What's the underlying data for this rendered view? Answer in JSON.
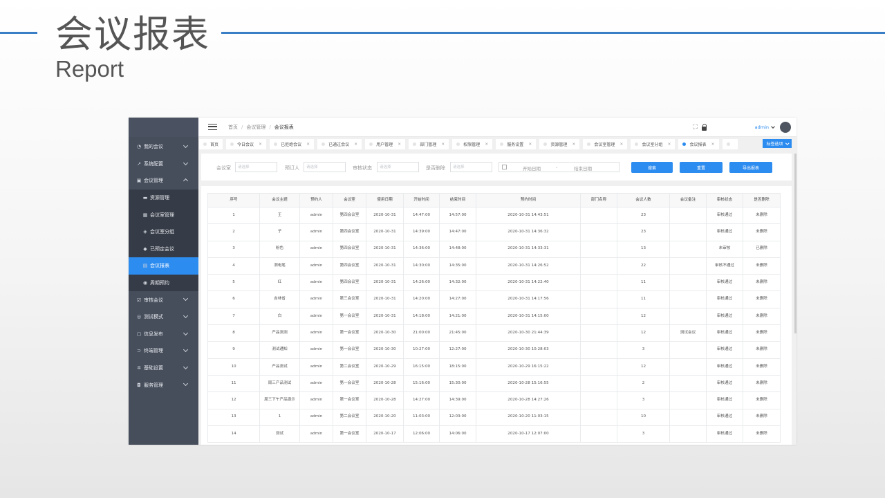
{
  "slide": {
    "title": "会议报表",
    "subtitle": "Report"
  },
  "sidebar": {
    "items": [
      {
        "label": "我的会议",
        "icon": "gauge-icon"
      },
      {
        "label": "系统配置",
        "icon": "wrench-icon"
      },
      {
        "label": "会议管理",
        "icon": "calendar-icon"
      }
    ],
    "submenu": [
      {
        "label": "资源管理",
        "icon": "server-icon"
      },
      {
        "label": "会议室管理",
        "icon": "room-icon"
      },
      {
        "label": "会议室分组",
        "icon": "layers-icon"
      },
      {
        "label": "已预定会议",
        "icon": "cube-icon"
      },
      {
        "label": "会议报表",
        "icon": "report-icon"
      },
      {
        "label": "周期预约",
        "icon": "cycle-icon"
      }
    ],
    "items_after": [
      {
        "label": "审核会议",
        "icon": "check-calendar-icon"
      },
      {
        "label": "测试模式",
        "icon": "test-icon"
      },
      {
        "label": "信息发布",
        "icon": "info-icon"
      },
      {
        "label": "终端管理",
        "icon": "terminal-icon"
      },
      {
        "label": "基础设置",
        "icon": "gear-icon"
      },
      {
        "label": "服务管理",
        "icon": "database-icon"
      }
    ]
  },
  "breadcrumb": [
    "首页",
    "会议管理",
    "会议报表"
  ],
  "header": {
    "user": "admin"
  },
  "tabs": [
    {
      "label": "首页",
      "closable": false
    },
    {
      "label": "今日会议",
      "closable": true
    },
    {
      "label": "已拒绝会议",
      "closable": true
    },
    {
      "label": "已通过会议",
      "closable": true
    },
    {
      "label": "用户管理",
      "closable": true
    },
    {
      "label": "部门管理",
      "closable": true
    },
    {
      "label": "权限管理",
      "closable": true
    },
    {
      "label": "服务设置",
      "closable": true
    },
    {
      "label": "资源管理",
      "closable": true
    },
    {
      "label": "会议室管理",
      "closable": true
    },
    {
      "label": "会议室分组",
      "closable": true
    },
    {
      "label": "会议报表",
      "closable": true
    },
    {
      "label": "",
      "closable": false
    }
  ],
  "tab_menu": "标签选项",
  "filters": {
    "room_label": "会议室",
    "room_placeholder": "请选择",
    "booker_label": "预订人",
    "booker_placeholder": "请选择",
    "status_label": "审核状态",
    "status_placeholder": "请选择",
    "deleted_label": "是否删除",
    "deleted_placeholder": "请选择",
    "start_date": "开始日期",
    "date_sep": "-",
    "end_date": "结束日期",
    "search_btn": "搜索",
    "reset_btn": "重置",
    "export_btn": "导出报表"
  },
  "table": {
    "columns": [
      "序号",
      "会议主题",
      "预约人",
      "会议室",
      "使用日期",
      "开始时间",
      "结束时间",
      "预约时间",
      "部门名称",
      "会议人数",
      "会议备注",
      "审核状态",
      "是否删除"
    ],
    "rows": [
      [
        "1",
        "王",
        "admin",
        "第四会议室",
        "2020-10-31",
        "14:47:00",
        "14:57:00",
        "2020-10-31 14:43:51",
        "",
        "23",
        "",
        "审核通过",
        "未删除"
      ],
      [
        "2",
        "子",
        "admin",
        "第四会议室",
        "2020-10-31",
        "14:39:00",
        "14:47:00",
        "2020-10-31 14:36:32",
        "",
        "23",
        "",
        "审核通过",
        "未删除"
      ],
      [
        "3",
        "粉色",
        "admin",
        "第四会议室",
        "2020-10-31",
        "14:36:00",
        "14:48:00",
        "2020-10-31 14:33:31",
        "",
        "13",
        "",
        "未审核",
        "已删除"
      ],
      [
        "4",
        "洞电笔",
        "admin",
        "第四会议室",
        "2020-10-31",
        "14:30:00",
        "14:35:00",
        "2020-10-31 14:26:52",
        "",
        "22",
        "",
        "审核不通过",
        "未删除"
      ],
      [
        "5",
        "红",
        "admin",
        "第四会议室",
        "2020-10-31",
        "14:26:00",
        "14:32:00",
        "2020-10-31 14:22:40",
        "",
        "11",
        "",
        "审核通过",
        "未删除"
      ],
      [
        "6",
        "吉林省",
        "admin",
        "第三会议室",
        "2020-10-31",
        "14:20:00",
        "14:27:00",
        "2020-10-31 14:17:56",
        "",
        "11",
        "",
        "审核通过",
        "未删除"
      ],
      [
        "7",
        "白",
        "admin",
        "第一会议室",
        "2020-10-31",
        "14:18:00",
        "14:21:00",
        "2020-10-31 14:15:00",
        "",
        "12",
        "",
        "审核通过",
        "未删除"
      ],
      [
        "8",
        "产品测测",
        "admin",
        "第一会议室",
        "2020-10-30",
        "21:00:00",
        "21:45:00",
        "2020-10-30 21:44:39",
        "",
        "12",
        "测试会议",
        "审核通过",
        "未删除"
      ],
      [
        "9",
        "测试通知",
        "admin",
        "第一会议室",
        "2020-10-30",
        "10:27:00",
        "12:27:00",
        "2020-10-30 10:28:03",
        "",
        "3",
        "",
        "审核通过",
        "未删除"
      ],
      [
        "10",
        "产品测试",
        "admin",
        "第二会议室",
        "2020-10-29",
        "16:15:00",
        "18:15:00",
        "2020-10-29 16:15:22",
        "",
        "12",
        "",
        "审核通过",
        "未删除"
      ],
      [
        "11",
        "周三产品测试",
        "admin",
        "第一会议室",
        "2020-10-28",
        "15:16:00",
        "15:30:00",
        "2020-10-28 15:16:55",
        "",
        "2",
        "",
        "审核通过",
        "未删除"
      ],
      [
        "12",
        "周三下午产品演示",
        "admin",
        "第一会议室",
        "2020-10-28",
        "14:27:00",
        "14:39:00",
        "2020-10-28 14:27:26",
        "",
        "3",
        "",
        "审核通过",
        "未删除"
      ],
      [
        "13",
        "1",
        "admin",
        "第二会议室",
        "2020-10-20",
        "11:03:00",
        "12:03:00",
        "2020-10-20 11:03:15",
        "",
        "10",
        "",
        "审核通过",
        "未删除"
      ],
      [
        "14",
        "测试",
        "admin",
        "第一会议室",
        "2020-10-17",
        "12:06:00",
        "14:06:00",
        "2020-10-17 12:07:00",
        "",
        "3",
        "",
        "审核通过",
        "未删除"
      ]
    ]
  }
}
